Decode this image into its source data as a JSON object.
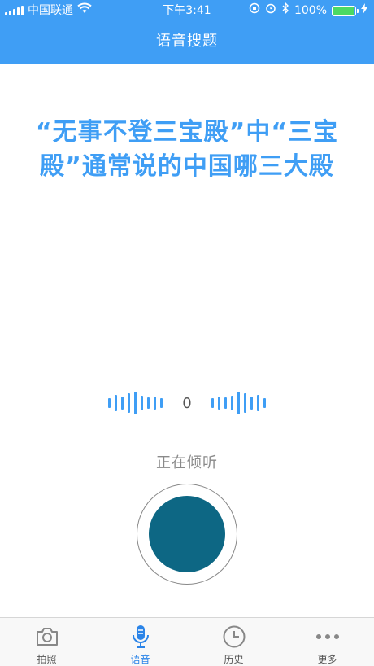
{
  "status_bar": {
    "carrier": "中国联通",
    "time": "下午3:41",
    "battery": "100%"
  },
  "nav": {
    "title": "语音搜题"
  },
  "question": {
    "text": "“无事不登三宝殿”中“三宝殿”通常说的中国哪三大殿"
  },
  "voice": {
    "level": "0",
    "status": "正在倾听"
  },
  "tabs": [
    {
      "label": "拍照",
      "icon": "camera-icon"
    },
    {
      "label": "语音",
      "icon": "microphone-icon",
      "active": true
    },
    {
      "label": "历史",
      "icon": "clock-icon"
    },
    {
      "label": "更多",
      "icon": "more-dots-icon"
    }
  ],
  "colors": {
    "primary": "#3f9ef5",
    "tab_active": "#2b84e8",
    "mic_fill": "#0d6784"
  }
}
